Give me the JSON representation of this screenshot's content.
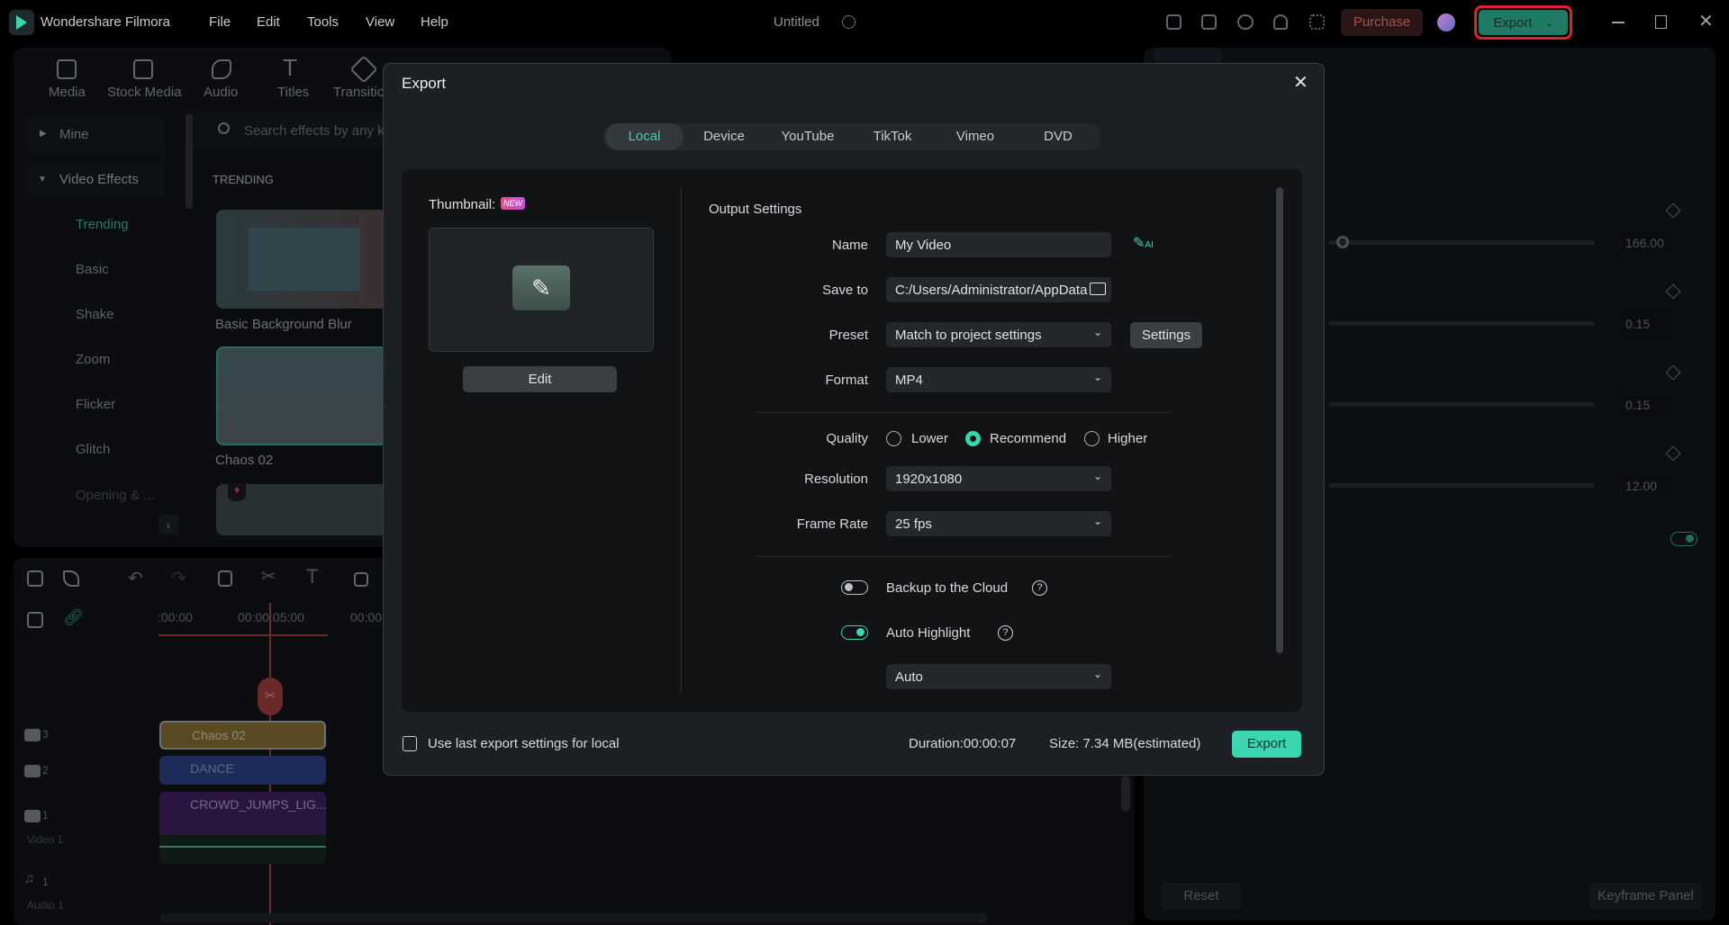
{
  "app": {
    "title": "Wondershare Filmora",
    "project": "Untitled",
    "menu": [
      "File",
      "Edit",
      "Tools",
      "View",
      "Help"
    ],
    "purchase": "Purchase",
    "export": "Export",
    "accent": "#3ad6b0",
    "export_outline": "#e0202a"
  },
  "toolbar": {
    "items": [
      "Media",
      "Stock Media",
      "Audio",
      "Titles",
      "Transitio"
    ]
  },
  "sidebar": {
    "mine": "Mine",
    "video_effects": "Video Effects",
    "items": [
      "Trending",
      "Basic",
      "Shake",
      "Zoom",
      "Flicker",
      "Glitch",
      "Opening & ..."
    ]
  },
  "effects": {
    "search_placeholder": "Search effects by any k",
    "section": "TRENDING",
    "items": [
      "Basic Background Blur",
      "Chaos 02"
    ]
  },
  "properties": {
    "values": [
      "166.00",
      "0.15",
      "0.15",
      "12.00"
    ],
    "reset": "Reset",
    "keyframe": "Keyframe Panel"
  },
  "timeline": {
    "ruler": [
      ":00:00",
      "00:00:05:00",
      "00:00"
    ],
    "tracks": [
      {
        "num": "3",
        "clip": "Chaos 02"
      },
      {
        "num": "2",
        "clip": "DANCE"
      },
      {
        "num": "1",
        "clip": "CROWD_JUMPS_LIG...",
        "name": "Video 1"
      },
      {
        "num": "1",
        "name": "Audio 1"
      }
    ]
  },
  "dialog": {
    "title": "Export",
    "tabs": [
      "Local",
      "Device",
      "YouTube",
      "TikTok",
      "Vimeo",
      "DVD"
    ],
    "active_tab": "Local",
    "thumbnail_label": "Thumbnail:",
    "new_badge": "NEW",
    "edit": "Edit",
    "output_settings": "Output Settings",
    "name_label": "Name",
    "name_value": "My Video",
    "save_label": "Save to",
    "save_value": "C:/Users/Administrator/AppData",
    "preset_label": "Preset",
    "preset_value": "Match to project settings",
    "settings": "Settings",
    "format_label": "Format",
    "format_value": "MP4",
    "quality_label": "Quality",
    "quality_options": [
      "Lower",
      "Recommend",
      "Higher"
    ],
    "quality_selected": "Recommend",
    "resolution_label": "Resolution",
    "resolution_value": "1920x1080",
    "framerate_label": "Frame Rate",
    "framerate_value": "25 fps",
    "backup_label": "Backup to the Cloud",
    "backup_on": false,
    "highlight_label": "Auto Highlight",
    "highlight_on": true,
    "highlight_value": "Auto",
    "use_last": "Use last export settings for local",
    "duration": "Duration:00:00:07",
    "size": "Size: 7.34 MB(estimated)",
    "export": "Export"
  }
}
